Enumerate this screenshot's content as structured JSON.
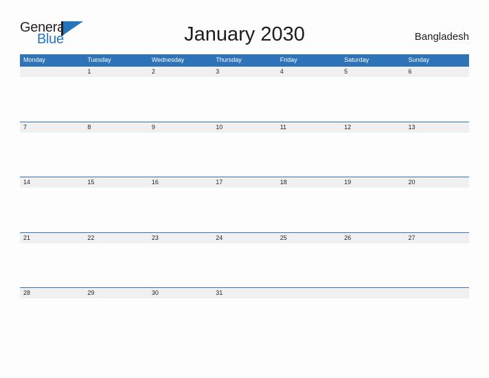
{
  "brand": {
    "name_part1": "General",
    "name_part2": "Blue",
    "flag_icon": "triangle-flag-icon",
    "color_dark": "#231f20",
    "color_blue": "#2575bd"
  },
  "header": {
    "title": "January 2030",
    "locale": "Bangladesh"
  },
  "calendar": {
    "accent_color": "#2e72b8",
    "band_color": "#f0f0f0",
    "weekdays": [
      "Monday",
      "Tuesday",
      "Wednesday",
      "Thursday",
      "Friday",
      "Saturday",
      "Sunday"
    ],
    "weeks": [
      [
        "",
        "1",
        "2",
        "3",
        "4",
        "5",
        "6"
      ],
      [
        "7",
        "8",
        "9",
        "10",
        "11",
        "12",
        "13"
      ],
      [
        "14",
        "15",
        "16",
        "17",
        "18",
        "19",
        "20"
      ],
      [
        "21",
        "22",
        "23",
        "24",
        "25",
        "26",
        "27"
      ],
      [
        "28",
        "29",
        "30",
        "31",
        "",
        "",
        ""
      ]
    ]
  }
}
